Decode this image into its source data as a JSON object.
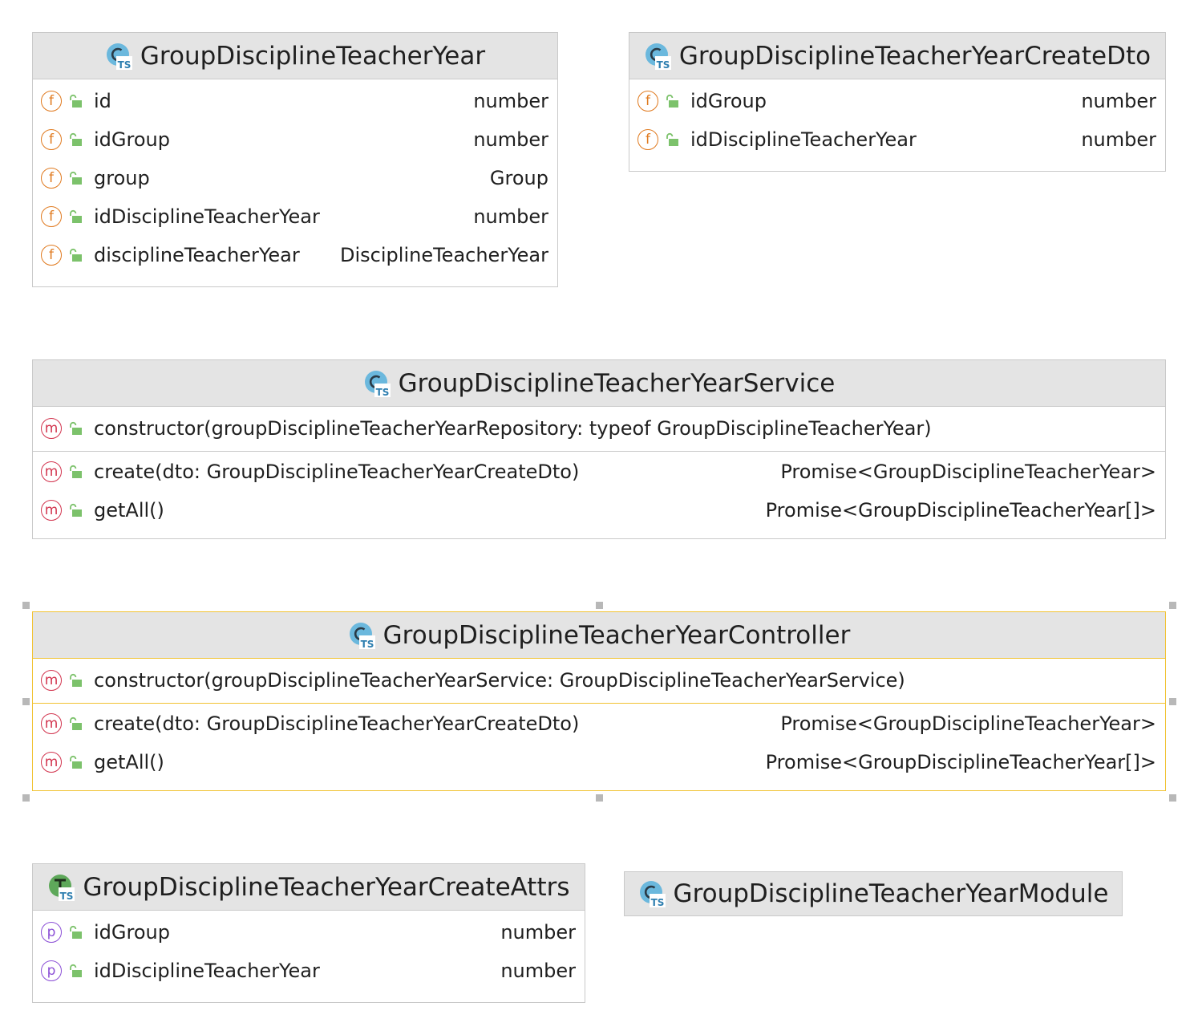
{
  "boxes": {
    "entity": {
      "title": "GroupDisciplineTeacherYear",
      "fields": [
        {
          "name": "id",
          "type": "number"
        },
        {
          "name": "idGroup",
          "type": "number"
        },
        {
          "name": "group",
          "type": "Group"
        },
        {
          "name": "idDisciplineTeacherYear",
          "type": "number"
        },
        {
          "name": "disciplineTeacherYear",
          "type": "DisciplineTeacherYear"
        }
      ]
    },
    "create_dto": {
      "title": "GroupDisciplineTeacherYearCreateDto",
      "fields": [
        {
          "name": "idGroup",
          "type": "number"
        },
        {
          "name": "idDisciplineTeacherYear",
          "type": "number"
        }
      ]
    },
    "service": {
      "title": "GroupDisciplineTeacherYearService",
      "constructor": "constructor(groupDisciplineTeacherYearRepository: typeof GroupDisciplineTeacherYear)",
      "methods": [
        {
          "name": "create(dto: GroupDisciplineTeacherYearCreateDto)",
          "type": "Promise<GroupDisciplineTeacherYear>"
        },
        {
          "name": "getAll()",
          "type": "Promise<GroupDisciplineTeacherYear[]>"
        }
      ]
    },
    "controller": {
      "title": "GroupDisciplineTeacherYearController",
      "constructor": "constructor(groupDisciplineTeacherYearService: GroupDisciplineTeacherYearService)",
      "methods": [
        {
          "name": "create(dto: GroupDisciplineTeacherYearCreateDto)",
          "type": "Promise<GroupDisciplineTeacherYear>"
        },
        {
          "name": "getAll()",
          "type": "Promise<GroupDisciplineTeacherYear[]>"
        }
      ]
    },
    "create_attrs": {
      "title": "GroupDisciplineTeacherYearCreateAttrs",
      "props": [
        {
          "name": "idGroup",
          "type": "number"
        },
        {
          "name": "idDisciplineTeacherYear",
          "type": "number"
        }
      ]
    },
    "module": {
      "title": "GroupDisciplineTeacherYearModule"
    }
  },
  "badges": {
    "field": "f",
    "method": "m",
    "property": "p"
  },
  "icons": {
    "class": "ts-class-icon",
    "interface": "ts-interface-icon",
    "visibility": "public-lock-icon"
  },
  "colors": {
    "selection": "#f1c232",
    "header": "#e4e4e4",
    "field": "#e07a1f",
    "method": "#d2344e",
    "property": "#8b4fd6",
    "lock": "#7cc26b",
    "class_icon": "#6bb8dd",
    "interface_icon": "#5ea85a"
  }
}
